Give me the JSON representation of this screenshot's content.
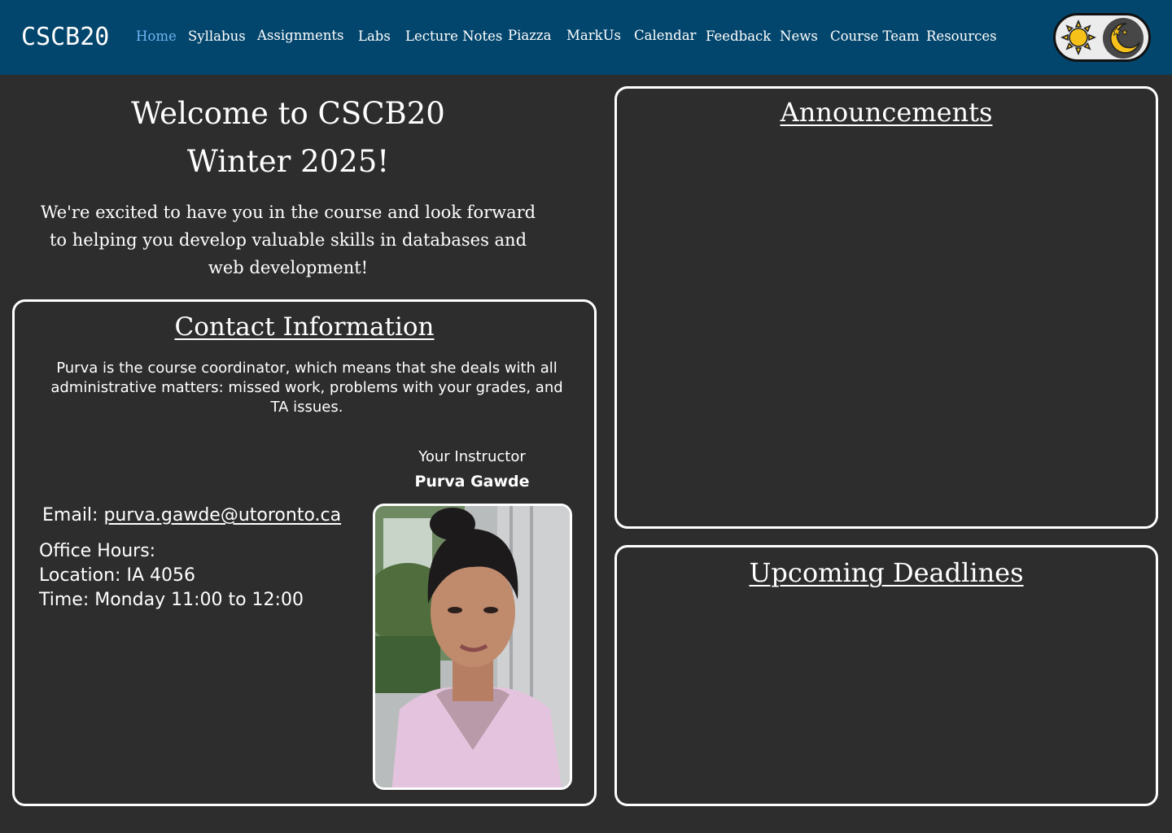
{
  "nav": {
    "brand": "CSCB20",
    "items": [
      {
        "label": "Home",
        "active": true
      },
      {
        "label": "Syllabus"
      },
      {
        "label": "Assignments"
      },
      {
        "label": "Labs"
      },
      {
        "label": "Lecture Notes"
      },
      {
        "label": "Piazza"
      },
      {
        "label": "MarkUs"
      },
      {
        "label": "Calendar"
      },
      {
        "label": "Feedback"
      },
      {
        "label": "News"
      },
      {
        "label": "Course Team"
      },
      {
        "label": "Resources"
      }
    ],
    "theme_toggle": {
      "icons": [
        "sun-icon",
        "moon-icon"
      ],
      "state": "dark"
    }
  },
  "welcome": {
    "title_line1": "Welcome to CSCB20",
    "title_line2": "Winter 2025!",
    "message": "We're excited to have you in the course and look forward to helping you develop valuable skills in databases and web development!"
  },
  "contact": {
    "title": "Contact Information",
    "description": "Purva is the course coordinator, which means that she deals with all administrative matters: missed work, problems with your grades, and TA issues.",
    "instructor_role": "Your Instructor",
    "instructor_name": "Purva Gawde",
    "email_label": "Email:",
    "email": "purva.gawde@utoronto.ca",
    "office_hours_label": "Office Hours:",
    "location": "Location: IA 4056",
    "time": "Time: Monday 11:00 to 12:00"
  },
  "announcements": {
    "title": "Announcements"
  },
  "deadlines": {
    "title": "Upcoming Deadlines"
  },
  "colors": {
    "navbar_bg": "#03466d",
    "page_bg": "#2d2d2d",
    "active_link": "#6cb6f2",
    "text": "#ffffff"
  }
}
